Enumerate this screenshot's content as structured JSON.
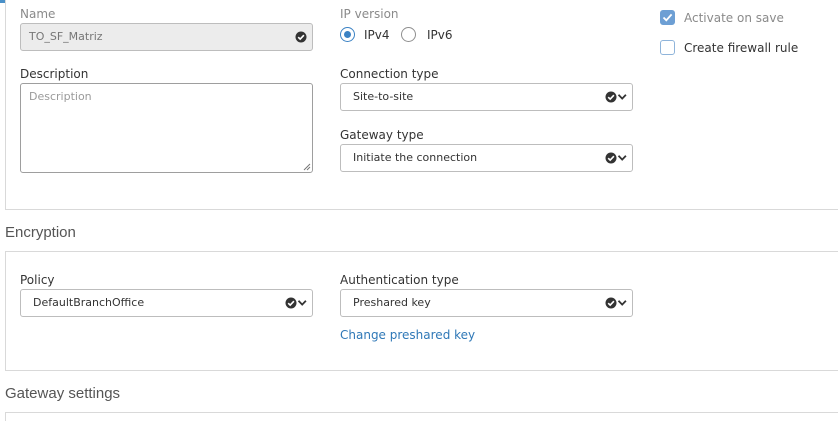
{
  "general": {
    "name": {
      "label": "Name",
      "value": "TO_SF_Matriz"
    },
    "description": {
      "label": "Description",
      "placeholder": "Description"
    },
    "ip_version": {
      "label": "IP version",
      "options": [
        "IPv4",
        "IPv6"
      ],
      "selected": "IPv4"
    },
    "connection_type": {
      "label": "Connection type",
      "value": "Site-to-site"
    },
    "gateway_type": {
      "label": "Gateway type",
      "value": "Initiate the connection"
    },
    "activate_on_save": {
      "label": "Activate on save",
      "checked": true
    },
    "create_firewall_rule": {
      "label": "Create firewall rule",
      "checked": false
    }
  },
  "encryption": {
    "title": "Encryption",
    "policy": {
      "label": "Policy",
      "value": "DefaultBranchOffice"
    },
    "authentication_type": {
      "label": "Authentication type",
      "value": "Preshared key"
    },
    "change_key_link": "Change preshared key"
  },
  "gateway_settings": {
    "title": "Gateway settings"
  },
  "colors": {
    "accent": "#3b82c4",
    "link": "#2f78b7",
    "checkbox": "#6d9fd4"
  }
}
